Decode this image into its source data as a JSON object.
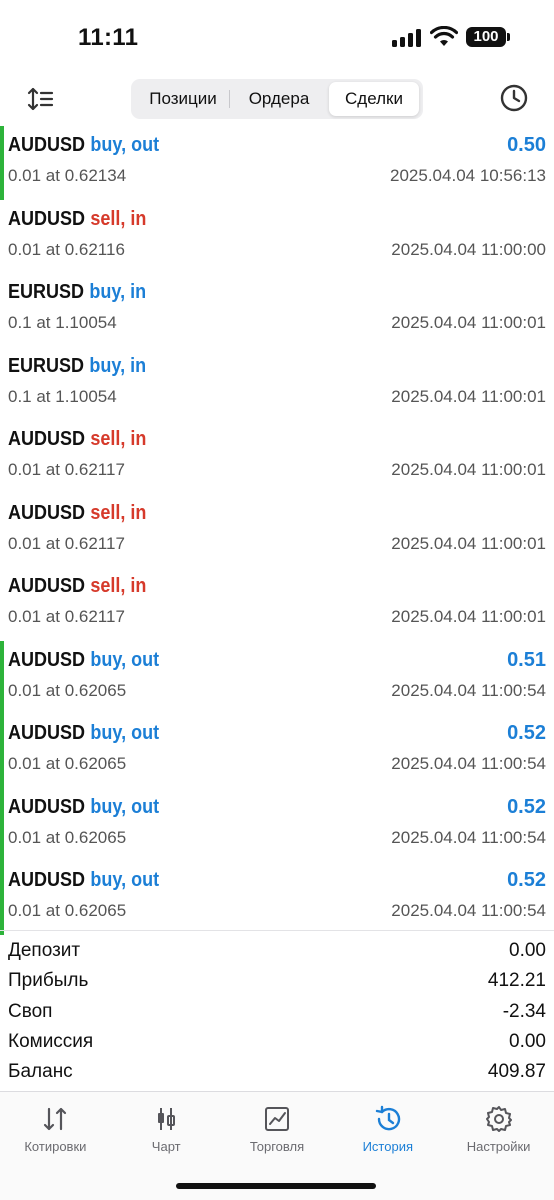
{
  "status_bar": {
    "time": "11:11",
    "battery": "100"
  },
  "toolbar": {
    "segments": [
      {
        "label": "Позиции",
        "active": false
      },
      {
        "label": "Ордера",
        "active": false
      },
      {
        "label": "Сделки",
        "active": true
      }
    ],
    "sort_icon": "sort-icon",
    "history_icon": "clock-icon"
  },
  "deals": [
    {
      "symbol": "AUDUSD",
      "side": "buy, out",
      "type": "buy",
      "profit": "0.50",
      "volume_price": "0.01 at 0.62134",
      "datetime": "2025.04.04 10:56:13"
    },
    {
      "symbol": "AUDUSD",
      "side": "sell, in",
      "type": "sell",
      "profit": "",
      "volume_price": "0.01 at 0.62116",
      "datetime": "2025.04.04 11:00:00"
    },
    {
      "symbol": "EURUSD",
      "side": "buy, in",
      "type": "buy",
      "profit": "",
      "volume_price": "0.1 at 1.10054",
      "datetime": "2025.04.04 11:00:01"
    },
    {
      "symbol": "EURUSD",
      "side": "buy, in",
      "type": "buy",
      "profit": "",
      "volume_price": "0.1 at 1.10054",
      "datetime": "2025.04.04 11:00:01"
    },
    {
      "symbol": "AUDUSD",
      "side": "sell, in",
      "type": "sell",
      "profit": "",
      "volume_price": "0.01 at 0.62117",
      "datetime": "2025.04.04 11:00:01"
    },
    {
      "symbol": "AUDUSD",
      "side": "sell, in",
      "type": "sell",
      "profit": "",
      "volume_price": "0.01 at 0.62117",
      "datetime": "2025.04.04 11:00:01"
    },
    {
      "symbol": "AUDUSD",
      "side": "sell, in",
      "type": "sell",
      "profit": "",
      "volume_price": "0.01 at 0.62117",
      "datetime": "2025.04.04 11:00:01"
    },
    {
      "symbol": "AUDUSD",
      "side": "buy, out",
      "type": "buy",
      "profit": "0.51",
      "volume_price": "0.01 at 0.62065",
      "datetime": "2025.04.04 11:00:54"
    },
    {
      "symbol": "AUDUSD",
      "side": "buy, out",
      "type": "buy",
      "profit": "0.52",
      "volume_price": "0.01 at 0.62065",
      "datetime": "2025.04.04 11:00:54"
    },
    {
      "symbol": "AUDUSD",
      "side": "buy, out",
      "type": "buy",
      "profit": "0.52",
      "volume_price": "0.01 at 0.62065",
      "datetime": "2025.04.04 11:00:54"
    },
    {
      "symbol": "AUDUSD",
      "side": "buy, out",
      "type": "buy",
      "profit": "0.52",
      "volume_price": "0.01 at 0.62065",
      "datetime": "2025.04.04 11:00:54"
    }
  ],
  "summary": [
    {
      "label": "Депозит",
      "value": "0.00"
    },
    {
      "label": "Прибыль",
      "value": "412.21"
    },
    {
      "label": "Своп",
      "value": "-2.34"
    },
    {
      "label": "Комиссия",
      "value": "0.00"
    },
    {
      "label": "Баланс",
      "value": "409.87"
    }
  ],
  "tabs": [
    {
      "label": "Котировки",
      "icon": "quotes-icon",
      "active": false
    },
    {
      "label": "Чарт",
      "icon": "chart-icon",
      "active": false
    },
    {
      "label": "Торговля",
      "icon": "trade-icon",
      "active": false
    },
    {
      "label": "История",
      "icon": "history-icon",
      "active": true
    },
    {
      "label": "Настройки",
      "icon": "settings-icon",
      "active": false
    }
  ],
  "colors": {
    "accent": "#1c7fd6",
    "sell": "#d63a2b",
    "profit_bar": "#2db33a"
  }
}
